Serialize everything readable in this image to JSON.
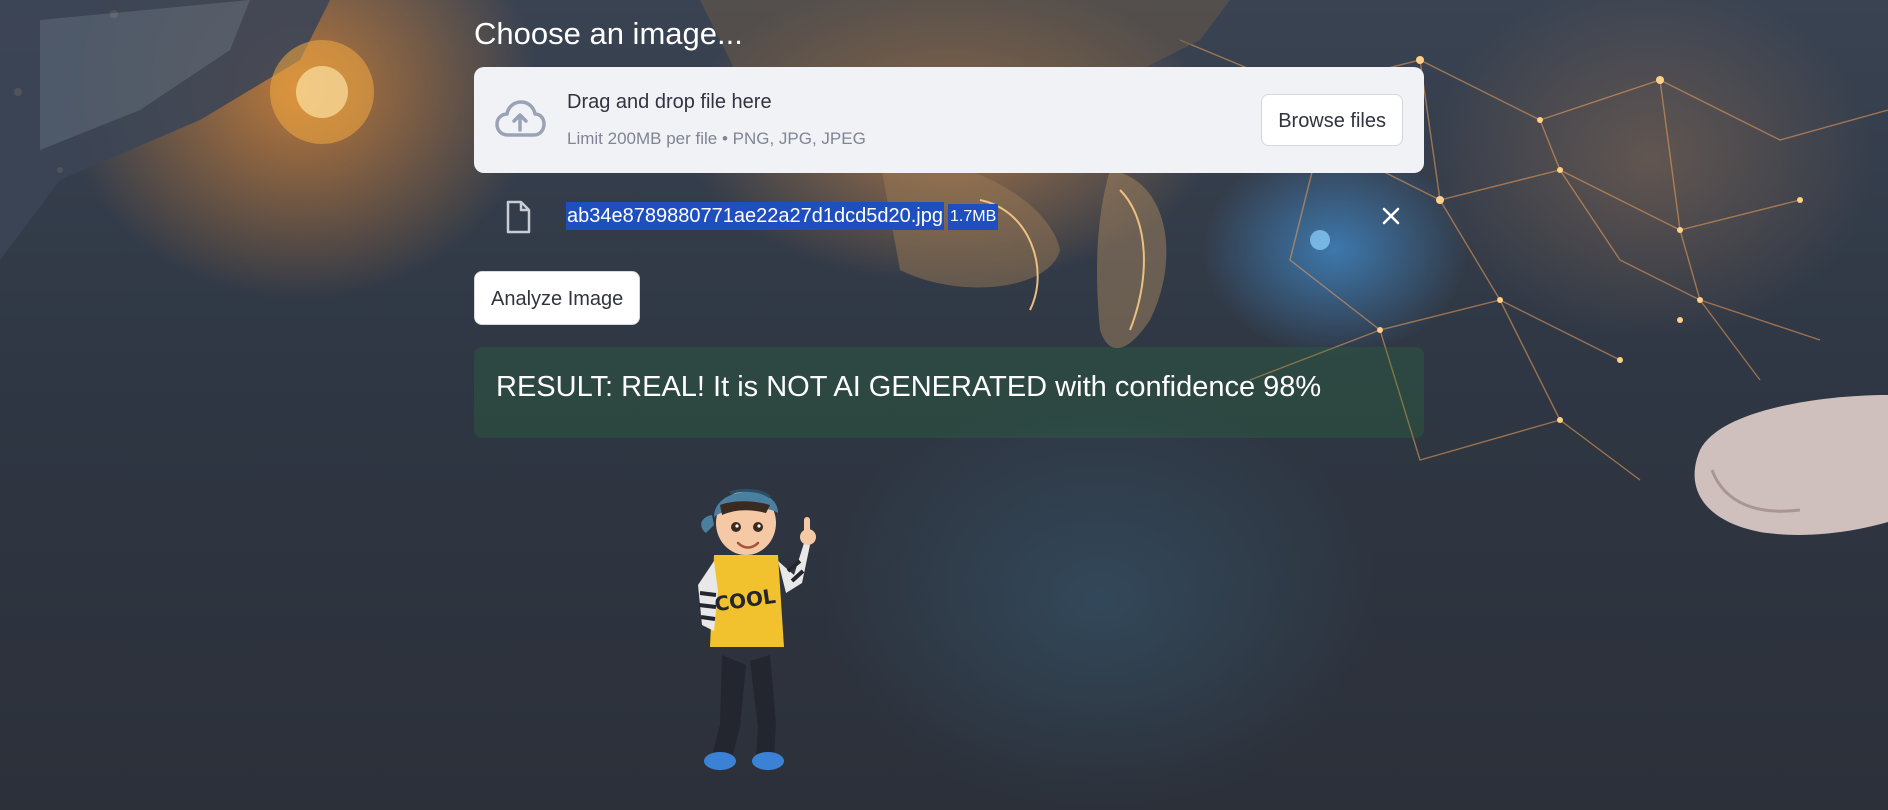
{
  "uploader": {
    "label": "Choose an image...",
    "drop_title": "Drag and drop file here",
    "drop_limits": "Limit 200MB per file • PNG, JPG, JPEG",
    "browse_label": "Browse files",
    "cloud_icon": "cloud-upload-icon"
  },
  "file": {
    "name": "ab34e8789880771ae22a27d1dcd5d20.jpg",
    "size": "1.7MB",
    "file_icon": "file-icon",
    "remove_icon": "close-icon"
  },
  "actions": {
    "analyze_label": "Analyze Image"
  },
  "result": {
    "text": "RESULT: REAL! It is NOT AI GENERATED with confidence 98%",
    "color": "#2e8b3e"
  },
  "mascot": {
    "shirt_text": "COOL"
  },
  "colors": {
    "dropzone_bg": "#f0f2f6",
    "selection_bg": "#1f4fbf",
    "text_dark": "#31333f",
    "text_muted": "#808495"
  }
}
